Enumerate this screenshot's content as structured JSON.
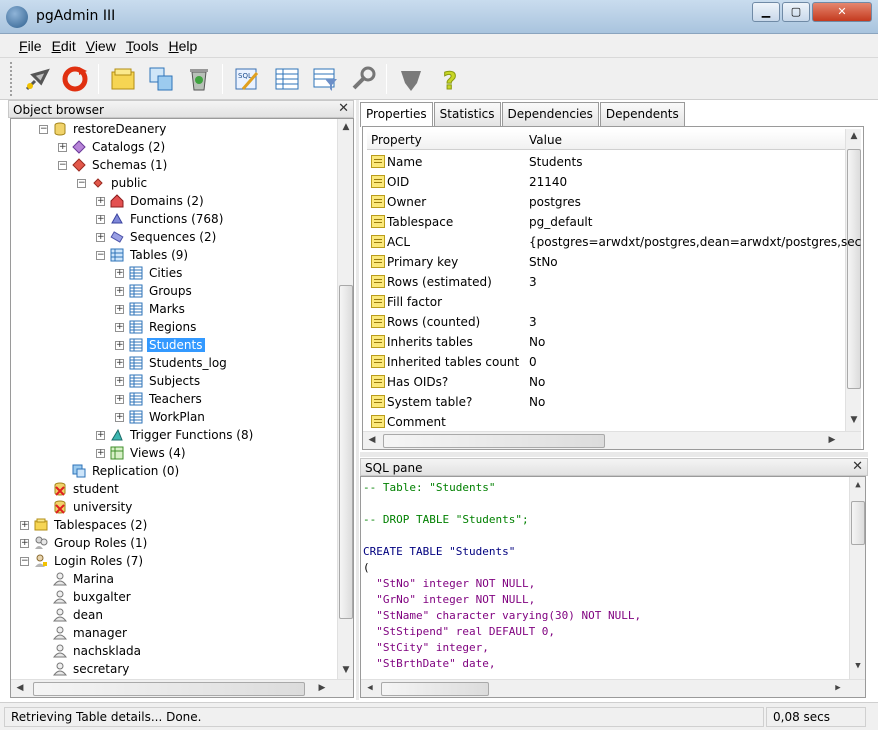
{
  "window": {
    "title": "pgAdmin III",
    "min": "▁",
    "max": "▢",
    "close": "✕"
  },
  "menu": [
    {
      "label": "File",
      "u": "F",
      "rest": "ile"
    },
    {
      "label": "Edit",
      "u": "E",
      "rest": "dit"
    },
    {
      "label": "View",
      "u": "V",
      "rest": "iew"
    },
    {
      "label": "Tools",
      "u": "T",
      "rest": "ools"
    },
    {
      "label": "Help",
      "u": "H",
      "rest": "elp"
    }
  ],
  "toolbar_icons": [
    "connect-icon",
    "refresh-icon",
    "properties-icon",
    "create-icon",
    "delete-icon",
    "sql-icon",
    "view-data-icon",
    "filter-icon",
    "maintenance-icon",
    "plugins-icon",
    "help-icon"
  ],
  "object_browser": {
    "title": "Object browser",
    "close": "✕",
    "items": [
      {
        "label": "restoreDeanery",
        "depth": 2,
        "exp": "−",
        "icon": "database-icon",
        "selected": false
      },
      {
        "label": "Catalogs (2)",
        "depth": 3,
        "exp": "+",
        "icon": "catalogs-icon",
        "selected": false
      },
      {
        "label": "Schemas (1)",
        "depth": 3,
        "exp": "−",
        "icon": "schemas-icon",
        "selected": false
      },
      {
        "label": "public",
        "depth": 4,
        "exp": "−",
        "icon": "schema-icon",
        "selected": false
      },
      {
        "label": "Domains (2)",
        "depth": 5,
        "exp": "+",
        "icon": "domains-icon",
        "selected": false
      },
      {
        "label": "Functions (768)",
        "depth": 5,
        "exp": "+",
        "icon": "functions-icon",
        "selected": false
      },
      {
        "label": "Sequences (2)",
        "depth": 5,
        "exp": "+",
        "icon": "sequences-icon",
        "selected": false
      },
      {
        "label": "Tables (9)",
        "depth": 5,
        "exp": "−",
        "icon": "tables-icon",
        "selected": false
      },
      {
        "label": "Cities",
        "depth": 6,
        "exp": "+",
        "icon": "table-icon",
        "selected": false
      },
      {
        "label": "Groups",
        "depth": 6,
        "exp": "+",
        "icon": "table-icon",
        "selected": false
      },
      {
        "label": "Marks",
        "depth": 6,
        "exp": "+",
        "icon": "table-icon",
        "selected": false
      },
      {
        "label": "Regions",
        "depth": 6,
        "exp": "+",
        "icon": "table-icon",
        "selected": false
      },
      {
        "label": "Students",
        "depth": 6,
        "exp": "+",
        "icon": "table-icon",
        "selected": true
      },
      {
        "label": "Students_log",
        "depth": 6,
        "exp": "+",
        "icon": "table-icon",
        "selected": false
      },
      {
        "label": "Subjects",
        "depth": 6,
        "exp": "+",
        "icon": "table-icon",
        "selected": false
      },
      {
        "label": "Teachers",
        "depth": 6,
        "exp": "+",
        "icon": "table-icon",
        "selected": false
      },
      {
        "label": "WorkPlan",
        "depth": 6,
        "exp": "+",
        "icon": "table-icon",
        "selected": false
      },
      {
        "label": "Trigger Functions (8)",
        "depth": 5,
        "exp": "+",
        "icon": "trigger-functions-icon",
        "selected": false
      },
      {
        "label": "Views (4)",
        "depth": 5,
        "exp": "+",
        "icon": "views-icon",
        "selected": false
      },
      {
        "label": "Replication (0)",
        "depth": 3,
        "exp": "",
        "icon": "replication-icon",
        "selected": false
      },
      {
        "label": "student",
        "depth": 2,
        "exp": "",
        "icon": "database-disconnected-icon",
        "selected": false
      },
      {
        "label": "university",
        "depth": 2,
        "exp": "",
        "icon": "database-disconnected-icon",
        "selected": false
      },
      {
        "label": "Tablespaces (2)",
        "depth": 1,
        "exp": "+",
        "icon": "tablespaces-icon",
        "selected": false
      },
      {
        "label": "Group Roles (1)",
        "depth": 1,
        "exp": "+",
        "icon": "group-roles-icon",
        "selected": false
      },
      {
        "label": "Login Roles (7)",
        "depth": 1,
        "exp": "−",
        "icon": "login-roles-icon",
        "selected": false
      },
      {
        "label": "Marina",
        "depth": 2,
        "exp": "",
        "icon": "user-icon",
        "selected": false
      },
      {
        "label": "buxgalter",
        "depth": 2,
        "exp": "",
        "icon": "user-icon",
        "selected": false
      },
      {
        "label": "dean",
        "depth": 2,
        "exp": "",
        "icon": "user-icon",
        "selected": false
      },
      {
        "label": "manager",
        "depth": 2,
        "exp": "",
        "icon": "user-icon",
        "selected": false
      },
      {
        "label": "nachsklada",
        "depth": 2,
        "exp": "",
        "icon": "user-icon",
        "selected": false
      },
      {
        "label": "secretary",
        "depth": 2,
        "exp": "",
        "icon": "user-icon",
        "selected": false
      }
    ]
  },
  "tabs": [
    "Properties",
    "Statistics",
    "Dependencies",
    "Dependents"
  ],
  "properties": {
    "header": {
      "property": "Property",
      "value": "Value"
    },
    "rows": [
      {
        "name": "Name",
        "value": "Students"
      },
      {
        "name": "OID",
        "value": "21140"
      },
      {
        "name": "Owner",
        "value": "postgres"
      },
      {
        "name": "Tablespace",
        "value": "pg_default"
      },
      {
        "name": "ACL",
        "value": "{postgres=arwdxt/postgres,dean=arwdxt/postgres,sec"
      },
      {
        "name": "Primary key",
        "value": "StNo"
      },
      {
        "name": "Rows (estimated)",
        "value": "3"
      },
      {
        "name": "Fill factor",
        "value": ""
      },
      {
        "name": "Rows (counted)",
        "value": "3"
      },
      {
        "name": "Inherits tables",
        "value": "No"
      },
      {
        "name": "Inherited tables count",
        "value": "0"
      },
      {
        "name": "Has OIDs?",
        "value": "No"
      },
      {
        "name": "System table?",
        "value": "No"
      },
      {
        "name": "Comment",
        "value": ""
      }
    ]
  },
  "sql_pane": {
    "title": "SQL pane",
    "close": "✕",
    "lines": [
      {
        "text": "-- Table: \"Students\"",
        "cls": "c-comment",
        "row": 0
      },
      {
        "text": "-- DROP TABLE \"Students\";",
        "cls": "c-comment",
        "row": 2
      },
      {
        "text": "CREATE TABLE \"Students\"",
        "cls": "c-kw",
        "row": 4
      },
      {
        "text": "(",
        "cls": "",
        "row": 5
      },
      {
        "text": "  \"StNo\" integer NOT NULL,",
        "cls": "c-str",
        "row": 6
      },
      {
        "text": "  \"GrNo\" integer NOT NULL,",
        "cls": "c-str",
        "row": 7
      },
      {
        "text": "  \"StName\" character varying(30) NOT NULL,",
        "cls": "c-str",
        "row": 8
      },
      {
        "text": "  \"StStipend\" real DEFAULT 0,",
        "cls": "c-str",
        "row": 9
      },
      {
        "text": "  \"StCity\" integer,",
        "cls": "c-str",
        "row": 10
      },
      {
        "text": "  \"StBrthDate\" date,",
        "cls": "c-str",
        "row": 11
      }
    ]
  },
  "status": {
    "message": "Retrieving Table details... Done.",
    "time": "0,08 secs"
  }
}
